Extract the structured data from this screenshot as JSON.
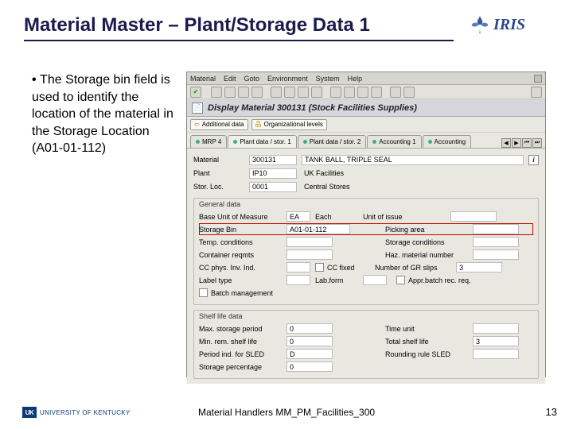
{
  "title": "Material Master – Plant/Storage Data 1",
  "logo": {
    "text": "IRIS"
  },
  "bullet": "The Storage bin field is used to identify the location of the material in the Storage Location (A01-01-112)",
  "sap": {
    "menu": [
      "Material",
      "Edit",
      "Goto",
      "Environment",
      "System",
      "Help"
    ],
    "window_title": "Display Material 300131 (Stock Facilities Supplies)",
    "tb2": {
      "btn1_arrow": "⇦",
      "btn1_label": "Additional data",
      "btn2_label": "Organizational levels"
    },
    "tabs": [
      {
        "label": "MRP 4",
        "active": false
      },
      {
        "label": "Plant data / stor. 1",
        "active": true
      },
      {
        "label": "Plant data / stor. 2",
        "active": false
      },
      {
        "label": "Accounting 1",
        "active": false
      },
      {
        "label": "Accounting",
        "active": false
      }
    ],
    "header_rows": [
      {
        "label": "Material",
        "value": "300131",
        "desc": "TANK BALL, TRIPLE SEAL",
        "info": true
      },
      {
        "label": "Plant",
        "value": "IP10",
        "desc": "UK Facilities"
      },
      {
        "label": "Stor. Loc.",
        "value": "0001",
        "desc": "Central Stores"
      }
    ],
    "group1": {
      "title": "General data",
      "rows": [
        {
          "l": "Base Unit of Measure",
          "v": "EA",
          "d": "Each",
          "r": "Unit of issue",
          "rv": ""
        },
        {
          "l": "Storage Bin",
          "v": "A01-01-112",
          "d": "",
          "r": "Picking area",
          "rv": "",
          "highlight": true
        },
        {
          "l": "Temp. conditions",
          "v": "",
          "d": "",
          "r": "Storage conditions",
          "rv": ""
        },
        {
          "l": "Container reqmts",
          "v": "",
          "d": "",
          "r": "Haz. material number",
          "rv": ""
        },
        {
          "l": "CC phys. Inv. Ind.",
          "v": "",
          "chk": "CC fixed",
          "r": "Number of GR slips",
          "rv": "3"
        },
        {
          "l": "Label type",
          "v": "",
          "d": "Lab.form",
          "r": "",
          "chk2": "Appr.batch rec. req."
        },
        {
          "chkl": "Batch management"
        }
      ]
    },
    "group2": {
      "title": "Shelf life data",
      "rows": [
        {
          "l": "Max. storage period",
          "v": "0",
          "r": "Time unit",
          "rv": ""
        },
        {
          "l": "Min. rem. shelf life",
          "v": "0",
          "r": "Total shelf life",
          "rv": "3"
        },
        {
          "l": "Period ind. for SLED",
          "v": "D",
          "r": "Rounding rule SLED",
          "rv": ""
        },
        {
          "l": "Storage percentage",
          "v": "0",
          "r": "",
          "rv": ""
        }
      ]
    }
  },
  "footer": {
    "uk": "UK",
    "uk_text": "UNIVERSITY OF KENTUCKY",
    "center": "Material Handlers MM_PM_Facilities_300",
    "page": "13"
  }
}
